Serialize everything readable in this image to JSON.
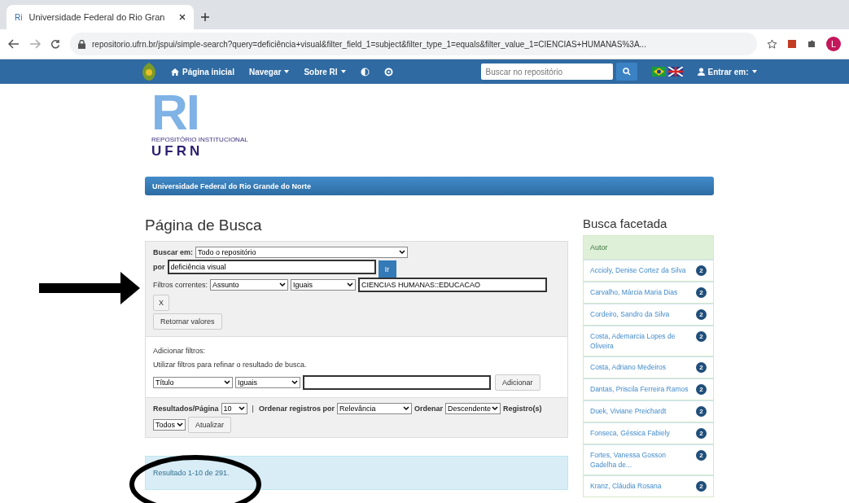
{
  "browser": {
    "tab_title": "Universidade Federal do Rio Gran",
    "tab_icon": "Ri",
    "url": "repositorio.ufrn.br/jspui/simple-search?query=deficiência+visual&filter_field_1=subject&filter_type_1=equals&filter_value_1=CIENCIAS+HUMANAS%3A...",
    "avatar": "L"
  },
  "navbar": {
    "items": [
      {
        "label": "Página inicial",
        "kind": "home"
      },
      {
        "label": "Navegar",
        "kind": "dropdown"
      },
      {
        "label": "Sobre RI",
        "kind": "dropdown"
      }
    ],
    "search_placeholder": "Buscar no repositório",
    "login": "Entrar em:"
  },
  "logo": {
    "letters": "RI",
    "subtitle": "REPOSITÓRIO INSTITUCIONAL",
    "name": "UFRN"
  },
  "banner": "Universidade Federal do Rio Grande do Norte",
  "page_title": "Página de Busca",
  "search": {
    "scope_label": "Buscar em:",
    "scope": "Todo o repositório",
    "query_label": "por",
    "query": "deficiência visual",
    "go": "Ir",
    "filters_label": "Filtros correntes:",
    "filter": {
      "field": "Assunto",
      "type": "Iguais",
      "value": "CIENCIAS HUMANAS::EDUCACAO",
      "remove": "X"
    },
    "reset": "Retornar valores"
  },
  "add_filters": {
    "title": "Adicionar filtros:",
    "hint": "Utilizar filtros para refinar o resultado de busca.",
    "field": "Título",
    "type": "Iguais",
    "button": "Adicionar"
  },
  "options": {
    "per_page_label": "Resultados/Página",
    "per_page": "10",
    "sort_label": "Ordenar registros por",
    "sort": "Relevância",
    "order_label": "Ordenar",
    "order": "Descendente",
    "separator": "|",
    "records_label": "Registro(s)",
    "records": "Todos",
    "update": "Atualizar"
  },
  "result": "Resultado 1-10 de 291.",
  "facets": {
    "title": "Busca facetada",
    "heading": "Autor",
    "items": [
      {
        "name": "Accioly, Denise Cortez da Silva",
        "count": "2"
      },
      {
        "name": "Carvalho, Márcia Maria Dias",
        "count": "2"
      },
      {
        "name": "Cordeiro, Sandro da Silva",
        "count": "2"
      },
      {
        "name": "Costa, Ademarcia Lopes de Oliveira",
        "count": "2"
      },
      {
        "name": "Costa, Adriano Medeiros",
        "count": "2"
      },
      {
        "name": "Dantas, Priscila Ferreira Ramos",
        "count": "2"
      },
      {
        "name": "Duek, Viviane Preichardt",
        "count": "2"
      },
      {
        "name": "Fonseca, Géssica Fabiely",
        "count": "2"
      },
      {
        "name": "Fortes, Vanessa Gosson Gadelha de...",
        "count": "2"
      },
      {
        "name": "Kranz, Cláudia Rosana",
        "count": "2"
      }
    ]
  }
}
